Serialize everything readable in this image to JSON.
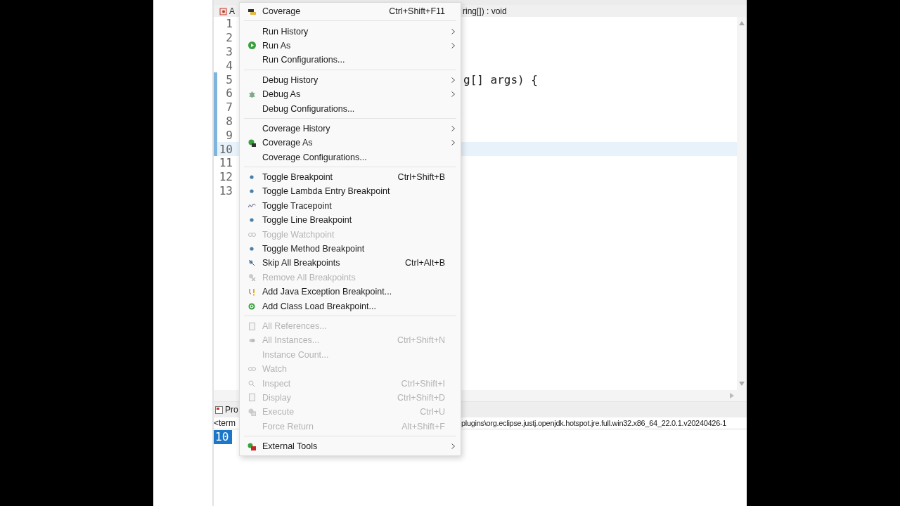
{
  "breadcrumb": {
    "file": "A",
    "method": "ring[]) : void"
  },
  "editor": {
    "lines": [
      {
        "number": "1",
        "marked": false,
        "current": false
      },
      {
        "number": "2",
        "marked": false,
        "current": false
      },
      {
        "number": "3",
        "marked": false,
        "current": false
      },
      {
        "number": "4",
        "marked": false,
        "current": false
      },
      {
        "number": "5",
        "marked": true,
        "current": false,
        "code": "g[] args) {"
      },
      {
        "number": "6",
        "marked": true,
        "current": false
      },
      {
        "number": "7",
        "marked": true,
        "current": false
      },
      {
        "number": "8",
        "marked": true,
        "current": false
      },
      {
        "number": "9",
        "marked": true,
        "current": false
      },
      {
        "number": "10",
        "marked": true,
        "current": true
      },
      {
        "number": "11",
        "marked": false,
        "current": false
      },
      {
        "number": "12",
        "marked": false,
        "current": false
      },
      {
        "number": "13",
        "marked": false,
        "current": false
      }
    ]
  },
  "bottom_panel": {
    "tab": "Pro",
    "console_header_start": "<term",
    "console_header_end": "plugins\\org.eclipse.justj.openjdk.hotspot.jre.full.win32.x86_64_22.0.1.v20240426-1",
    "output": "10"
  },
  "context_menu": {
    "groups": [
      {
        "items": [
          {
            "label": "Coverage",
            "shortcut": "Ctrl+Shift+F11",
            "submenu": false,
            "disabled": false
          }
        ]
      },
      {
        "items": [
          {
            "label": "Run History",
            "submenu": true,
            "disabled": false
          },
          {
            "label": "Run As",
            "submenu": true,
            "disabled": false
          },
          {
            "label": "Run Configurations...",
            "submenu": false,
            "disabled": false
          }
        ]
      },
      {
        "items": [
          {
            "label": "Debug History",
            "submenu": true,
            "disabled": false
          },
          {
            "label": "Debug As",
            "submenu": true,
            "disabled": false
          },
          {
            "label": "Debug Configurations...",
            "submenu": false,
            "disabled": false
          }
        ]
      },
      {
        "items": [
          {
            "label": "Coverage History",
            "submenu": true,
            "disabled": false
          },
          {
            "label": "Coverage As",
            "submenu": true,
            "disabled": false
          },
          {
            "label": "Coverage Configurations...",
            "submenu": false,
            "disabled": false
          }
        ]
      },
      {
        "items": [
          {
            "label": "Toggle Breakpoint",
            "shortcut": "Ctrl+Shift+B",
            "submenu": false,
            "disabled": false
          },
          {
            "label": "Toggle Lambda Entry Breakpoint",
            "submenu": false,
            "disabled": false
          },
          {
            "label": "Toggle Tracepoint",
            "submenu": false,
            "disabled": false
          },
          {
            "label": "Toggle Line Breakpoint",
            "submenu": false,
            "disabled": false
          },
          {
            "label": "Toggle Watchpoint",
            "submenu": false,
            "disabled": true
          },
          {
            "label": "Toggle Method Breakpoint",
            "submenu": false,
            "disabled": false
          },
          {
            "label": "Skip All Breakpoints",
            "shortcut": "Ctrl+Alt+B",
            "submenu": false,
            "disabled": false
          },
          {
            "label": "Remove All Breakpoints",
            "submenu": false,
            "disabled": true
          },
          {
            "label": "Add Java Exception Breakpoint...",
            "submenu": false,
            "disabled": false
          },
          {
            "label": "Add Class Load Breakpoint...",
            "submenu": false,
            "disabled": false
          }
        ]
      },
      {
        "items": [
          {
            "label": "All References...",
            "submenu": false,
            "disabled": true
          },
          {
            "label": "All Instances...",
            "shortcut": "Ctrl+Shift+N",
            "submenu": false,
            "disabled": true
          },
          {
            "label": "Instance Count...",
            "submenu": false,
            "disabled": true
          },
          {
            "label": "Watch",
            "submenu": false,
            "disabled": true
          },
          {
            "label": "Inspect",
            "shortcut": "Ctrl+Shift+I",
            "submenu": false,
            "disabled": true
          },
          {
            "label": "Display",
            "shortcut": "Ctrl+Shift+D",
            "submenu": false,
            "disabled": true
          },
          {
            "label": "Execute",
            "shortcut": "Ctrl+U",
            "submenu": false,
            "disabled": true
          },
          {
            "label": "Force Return",
            "shortcut": "Alt+Shift+F",
            "submenu": false,
            "disabled": true
          }
        ]
      },
      {
        "items": [
          {
            "label": "External Tools",
            "submenu": true,
            "disabled": false
          }
        ]
      }
    ]
  }
}
